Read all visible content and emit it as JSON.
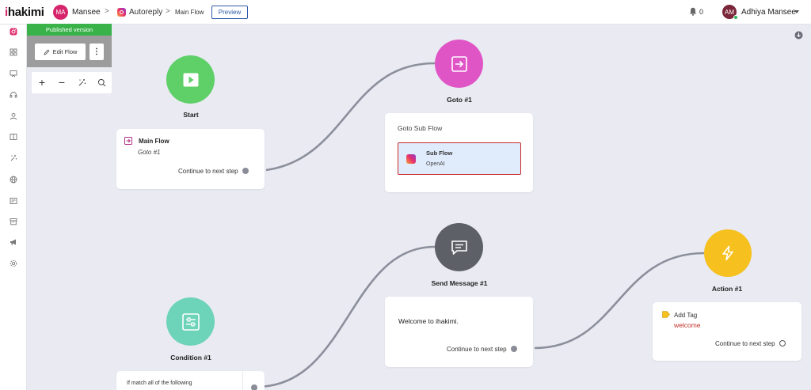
{
  "app": {
    "logo": "ihakimi"
  },
  "header": {
    "workspace_initials": "MA",
    "workspace_name": "Mansee",
    "channel": "Autoreply",
    "flow_name": "Main Flow",
    "preview_label": "Preview",
    "notification_count": "0",
    "user_initials": "AM",
    "user_name": "Adhiya Mansee"
  },
  "sidebar": {
    "items": [
      {
        "icon": "instagram-icon"
      },
      {
        "icon": "dashboard-icon"
      },
      {
        "icon": "broadcast-icon"
      },
      {
        "icon": "support-icon"
      },
      {
        "icon": "contacts-icon"
      },
      {
        "icon": "book-icon"
      },
      {
        "icon": "automation-icon"
      },
      {
        "icon": "globe-icon"
      },
      {
        "icon": "template-icon"
      },
      {
        "icon": "archive-icon"
      },
      {
        "icon": "megaphone-icon"
      },
      {
        "icon": "settings-icon"
      }
    ]
  },
  "editor": {
    "published_label": "Published version",
    "edit_flow_label": "Edit Flow"
  },
  "nodes": {
    "start": {
      "label": "Start",
      "card_title": "Main Flow",
      "card_subtitle": "Goto #1",
      "continue_label": "Continue to next step",
      "color": "#5fd068"
    },
    "goto": {
      "label": "Goto #1",
      "card_title": "Goto Sub Flow",
      "subflow_title": "Sub Flow",
      "subflow_subtitle": "OpenAI",
      "color": "#e055c6"
    },
    "send_message": {
      "label": "Send Message #1",
      "message": "Welcome to ihakimi.",
      "continue_label": "Continue to next step",
      "color": "#5d6067"
    },
    "action": {
      "label": "Action #1",
      "action_title": "Add Tag",
      "tag_value": "welcome",
      "continue_label": "Continue to next step",
      "color": "#f6c01e"
    },
    "condition": {
      "label": "Condition #1",
      "rule_text": "If match all of the following",
      "color": "#6dd3b9"
    }
  }
}
